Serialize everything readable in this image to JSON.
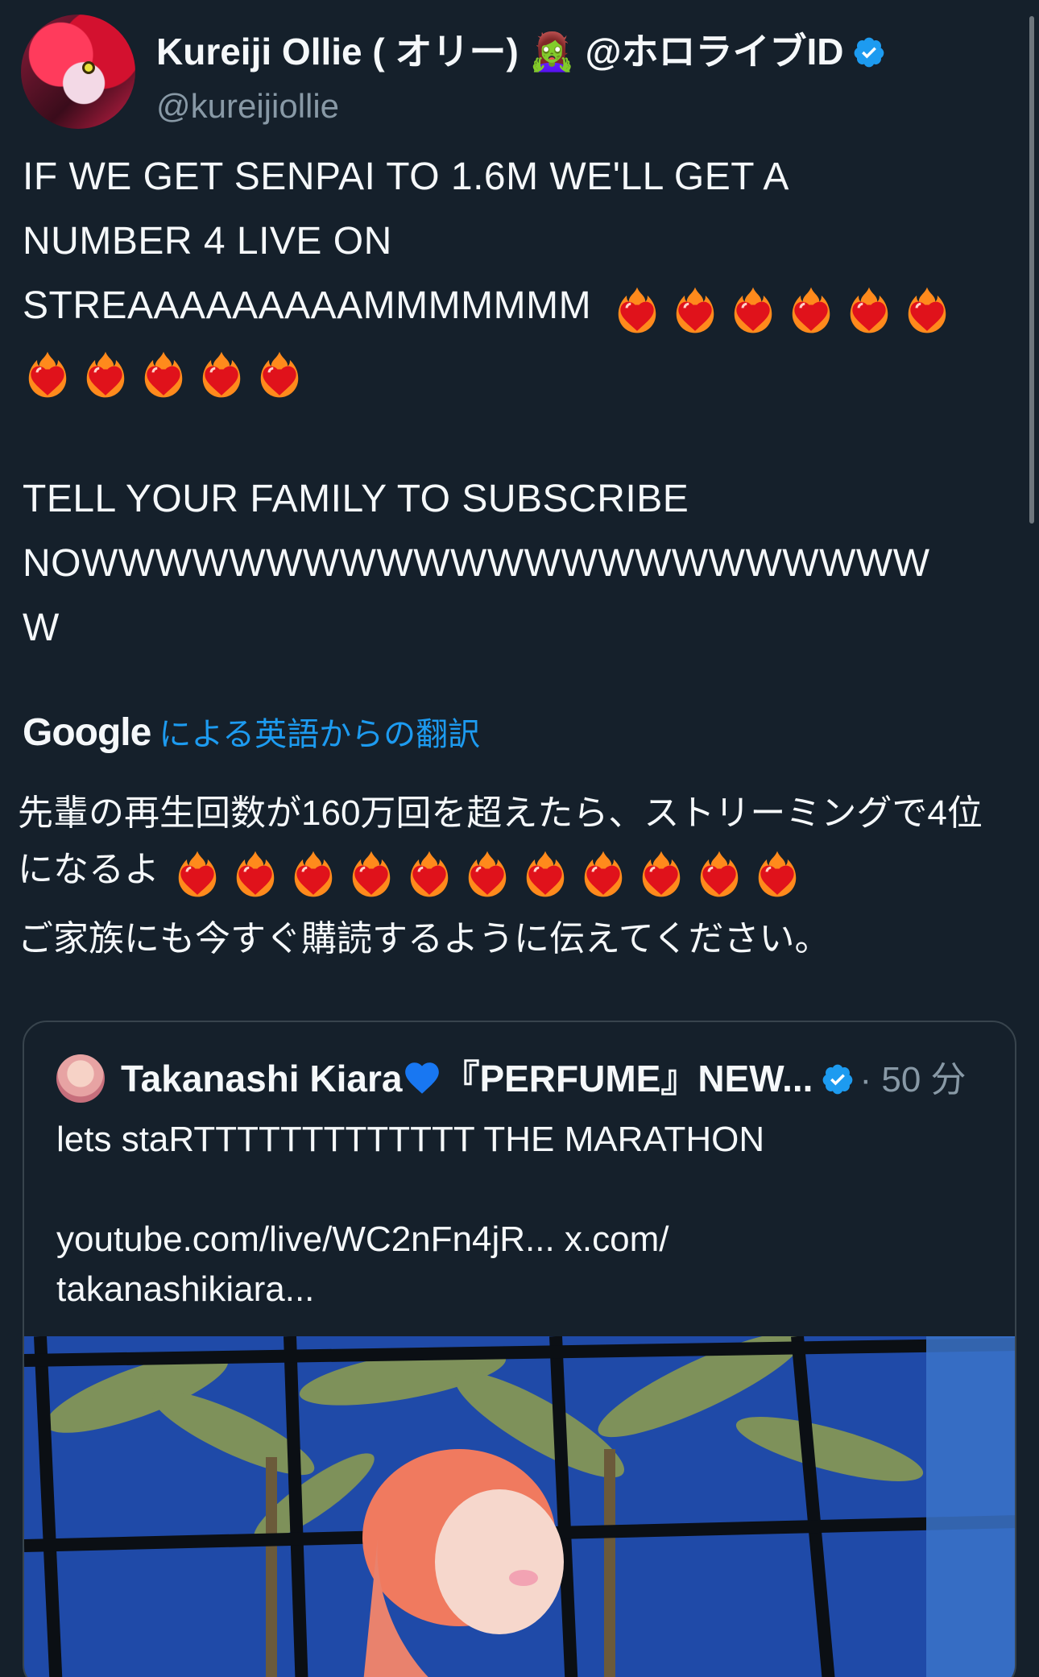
{
  "tweet": {
    "author": {
      "display_name": "Kureiji Ollie ( オリー) 🧟‍♀️ @ホロライブID",
      "handle": "@kureijiollie",
      "verified": true
    },
    "text_lines": [
      "IF WE GET SENPAI TO 1.6M WE'LL GET A",
      "NUMBER 4 LIVE ON",
      "STREAAAAAAAAAMMMMMMM",
      "",
      "",
      "TELL YOUR FAMILY TO SUBSCRIBE",
      "NOWWWWWWWWWWWWWWWWWWWWWWW",
      "W"
    ],
    "heart_emoji_count_line3": 6,
    "heart_emoji_count_line4": 5,
    "translation": {
      "provider": "Google",
      "link_label": "による英語からの翻訳",
      "lines": [
        "先輩の再生回数が160万回を超えたら、ストリーミングで4位",
        "になるよ",
        "ご家族にも今すぐ購読するように伝えてください。"
      ],
      "heart_emoji_count": 11
    }
  },
  "quoted_tweet": {
    "display_name": "Takanashi Kiara",
    "name_suffix": "『PERFUME』NEW...",
    "verified": true,
    "time": "· 50 分",
    "text_lines": [
      "lets staRTTTTTTTTTTTTT THE MARATHON",
      "",
      "youtube.com/live/WC2nFn4jR... x.com/",
      "takanashikiara..."
    ]
  },
  "colors": {
    "background": "#15202b",
    "text": "#f5f8fa",
    "secondary": "#8899a6",
    "accent": "#1d9bf0",
    "border": "#38444d"
  },
  "icons": [
    "verified-badge-icon",
    "heart-on-fire-emoji",
    "blue-heart-emoji"
  ]
}
